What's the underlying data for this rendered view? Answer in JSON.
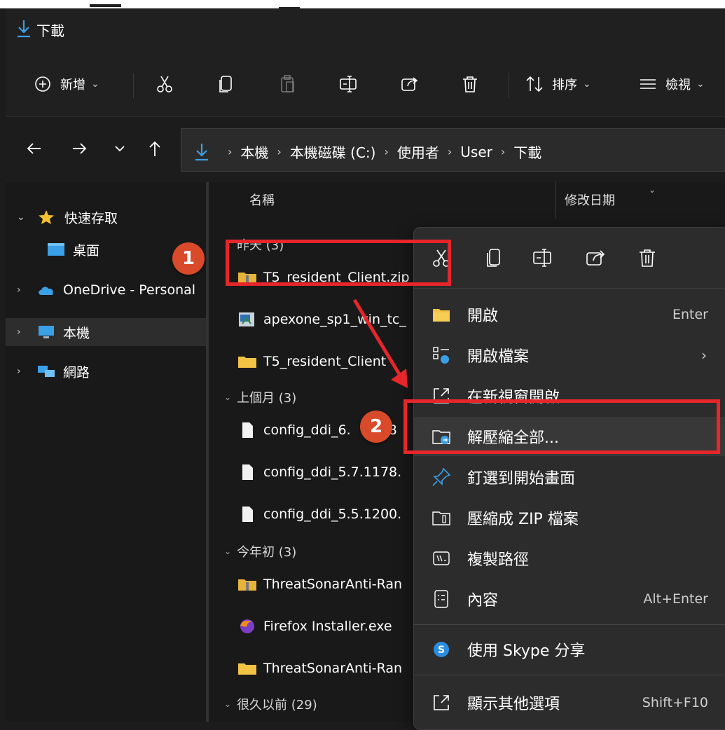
{
  "window": {
    "title": "下載"
  },
  "toolbar": {
    "new_label": "新增",
    "sort_label": "排序",
    "view_label": "檢視",
    "icons": [
      "add-icon",
      "cut-icon",
      "copy-icon",
      "paste-icon",
      "rename-icon",
      "share-icon",
      "delete-icon",
      "sort-icon",
      "view-icon"
    ]
  },
  "breadcrumb": [
    "本機",
    "本機磁碟 (C:)",
    "使用者",
    "User",
    "下載"
  ],
  "sidebar": {
    "items": [
      {
        "label": "快速存取",
        "icon": "star-icon",
        "expanded": true
      },
      {
        "label": "桌面",
        "icon": "desktop-icon"
      },
      {
        "label": "OneDrive - Personal",
        "icon": "cloud-icon"
      },
      {
        "label": "本機",
        "icon": "computer-icon",
        "selected": true
      },
      {
        "label": "網路",
        "icon": "network-icon"
      }
    ]
  },
  "columns": {
    "name": "名稱",
    "modified": "修改日期"
  },
  "groups": [
    {
      "label": "昨天 (3)"
    },
    {
      "label": "上個月 (3)"
    },
    {
      "label": "今年初 (3)"
    },
    {
      "label": "很久以前 (29)"
    }
  ],
  "files": [
    {
      "name": "T5_resident_Client.zip",
      "icon": "zip-folder-icon"
    },
    {
      "name": "apexone_sp1_win_tc_",
      "icon": "installer-icon"
    },
    {
      "name": "T5_resident_Client",
      "icon": "folder-icon"
    },
    {
      "name": "config_ddi_6.",
      "icon": "file-icon",
      "suffix": "8"
    },
    {
      "name": "config_ddi_5.7.1178.",
      "icon": "file-icon"
    },
    {
      "name": "config_ddi_5.5.1200.",
      "icon": "file-icon"
    },
    {
      "name": "ThreatSonarAnti-Ran",
      "icon": "zip-folder-icon"
    },
    {
      "name": "Firefox Installer.exe",
      "icon": "firefox-icon"
    },
    {
      "name": "ThreatSonarAnti-Ran",
      "icon": "folder-icon"
    }
  ],
  "context_menu": {
    "items": [
      {
        "label": "開啟",
        "shortcut": "Enter",
        "icon": "folder-open-icon"
      },
      {
        "label": "開啟檔案",
        "shortcut": "",
        "icon": "open-with-icon",
        "submenu": true
      },
      {
        "label": "在新視窗開啟",
        "shortcut": "",
        "icon": "new-window-icon"
      },
      {
        "label": "解壓縮全部...",
        "shortcut": "",
        "icon": "extract-icon",
        "highlighted": true
      },
      {
        "label": "釘選到開始畫面",
        "shortcut": "",
        "icon": "pin-icon"
      },
      {
        "label": "壓縮成 ZIP 檔案",
        "shortcut": "",
        "icon": "zip-icon"
      },
      {
        "label": "複製路徑",
        "shortcut": "",
        "icon": "copy-path-icon"
      },
      {
        "label": "內容",
        "shortcut": "Alt+Enter",
        "icon": "properties-icon"
      },
      {
        "label": "使用 Skype 分享",
        "shortcut": "",
        "icon": "skype-icon"
      },
      {
        "label": "顯示其他選項",
        "shortcut": "Shift+F10",
        "icon": "more-options-icon"
      }
    ]
  },
  "annotations": {
    "step1": "1",
    "step2": "2",
    "highlight_color": "#e5262b",
    "badge_color": "#d84a2a"
  }
}
